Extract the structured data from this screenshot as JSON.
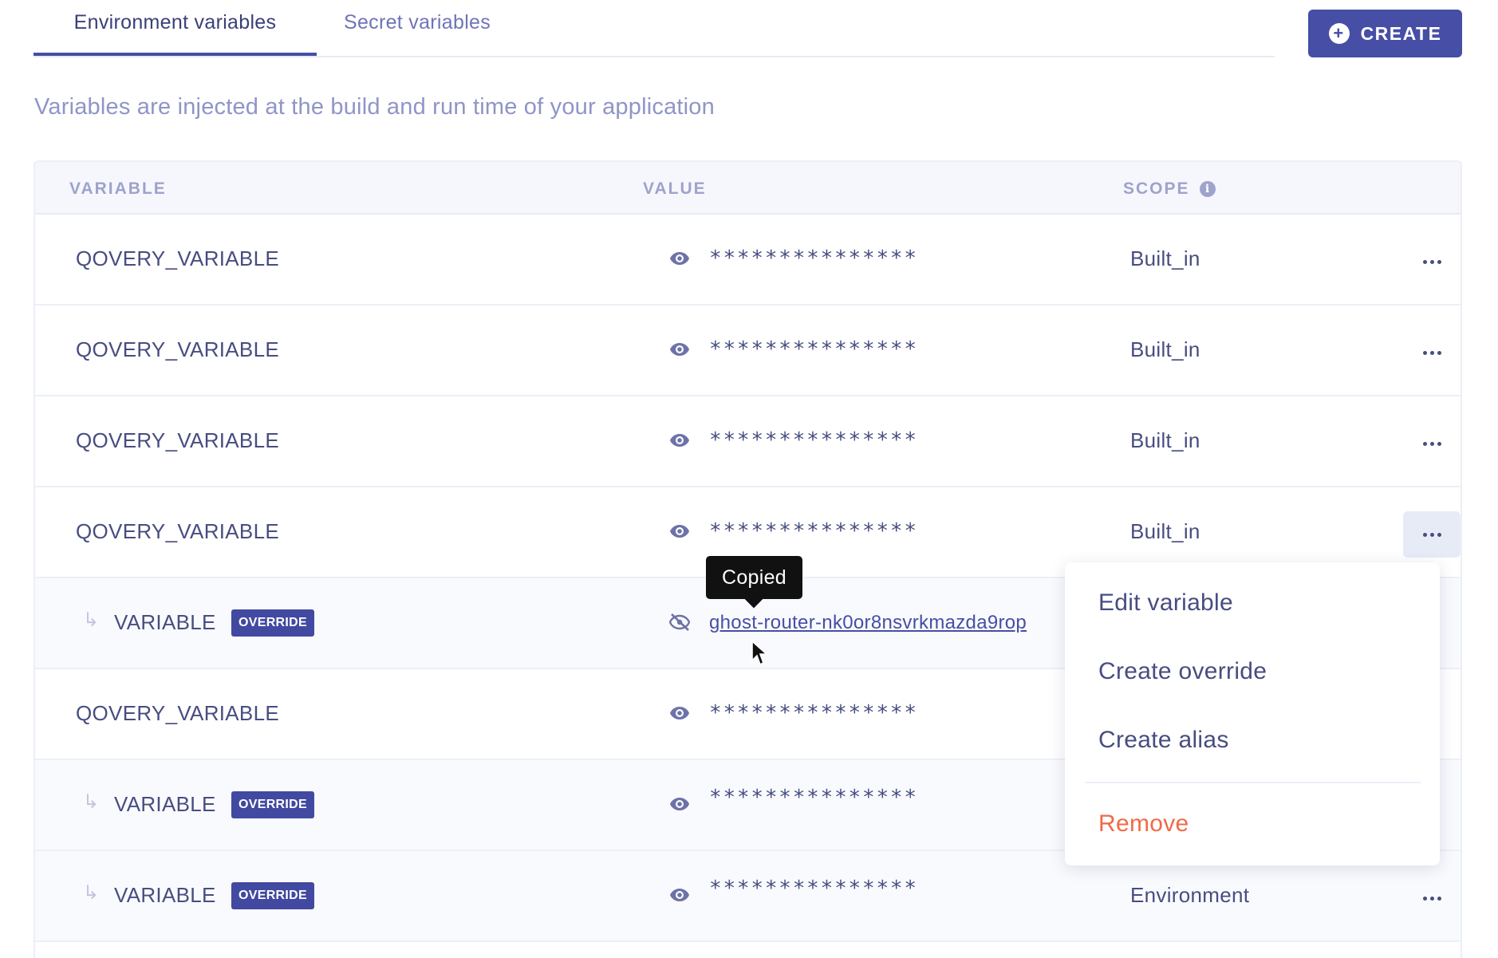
{
  "tabs": [
    {
      "label": "Environment variables",
      "active": true
    },
    {
      "label": "Secret variables",
      "active": false
    }
  ],
  "create_button": {
    "label": "CREATE"
  },
  "subtitle": "Variables are injected at the build and run time of your application",
  "table": {
    "headers": {
      "variable": "VARIABLE",
      "value": "VALUE",
      "scope": "SCOPE"
    },
    "rows": [
      {
        "name": "QOVERY_VARIABLE",
        "value": "***************",
        "scope": "Built_in",
        "override": false
      },
      {
        "name": "QOVERY_VARIABLE",
        "value": "***************",
        "scope": "Built_in",
        "override": false
      },
      {
        "name": "QOVERY_VARIABLE",
        "value": "***************",
        "scope": "Built_in",
        "override": false
      },
      {
        "name": "QOVERY_VARIABLE",
        "value": "***************",
        "scope": "Built_in",
        "override": false
      },
      {
        "name": "VARIABLE",
        "badge": "OVERRIDE",
        "value": "ghost-router-nk0or8nsvrkmazda9rop",
        "scope": "",
        "override": true,
        "revealed": true
      },
      {
        "name": "QOVERY_VARIABLE",
        "value": "***************",
        "scope": "",
        "override": false
      },
      {
        "name": "VARIABLE",
        "badge": "OVERRIDE",
        "value": "***************",
        "scope": "",
        "override": true
      },
      {
        "name": "VARIABLE",
        "badge": "OVERRIDE",
        "value": "***************",
        "scope": "Environment",
        "override": true
      }
    ]
  },
  "tooltip": "Copied",
  "menu": {
    "edit": "Edit variable",
    "create_override": "Create override",
    "create_alias": "Create alias",
    "remove": "Remove"
  },
  "colors": {
    "accent": "#464ea6",
    "remove": "#f06a47",
    "header_text": "#9ea3cc"
  },
  "icons": {
    "create": "plus-circle-icon",
    "eye": "eye-icon",
    "eye_off": "eye-slash-icon",
    "more": "ellipsis-icon",
    "sub_arrow": "subdirectory-arrow-icon",
    "info": "info-icon",
    "cursor": "mouse-pointer-icon"
  }
}
